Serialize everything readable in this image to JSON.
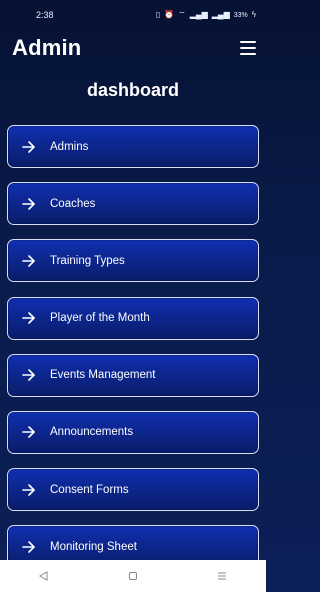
{
  "status_bar": {
    "time": "2:38",
    "battery_text": "33%"
  },
  "app_bar": {
    "title": "Admin",
    "menu_icon": "hamburger-menu-icon"
  },
  "page": {
    "title": "dashboard"
  },
  "menu": {
    "arrow_icon": "arrow-right-icon",
    "items": [
      {
        "label": "Admins"
      },
      {
        "label": "Coaches"
      },
      {
        "label": "Training Types"
      },
      {
        "label": "Player of the Month"
      },
      {
        "label": "Events Management"
      },
      {
        "label": "Announcements"
      },
      {
        "label": "Consent Forms"
      },
      {
        "label": "Monitoring Sheet"
      }
    ]
  },
  "nav_bar": {
    "back_icon": "triangle-back-icon",
    "home_icon": "square-home-icon",
    "recents_icon": "lines-recents-icon"
  },
  "colors": {
    "background_top": "#061233",
    "background_bottom": "#0c1f57",
    "button_top": "#0f2fb1",
    "button_bottom": "#0a1c69",
    "button_border": "#d7def5"
  }
}
